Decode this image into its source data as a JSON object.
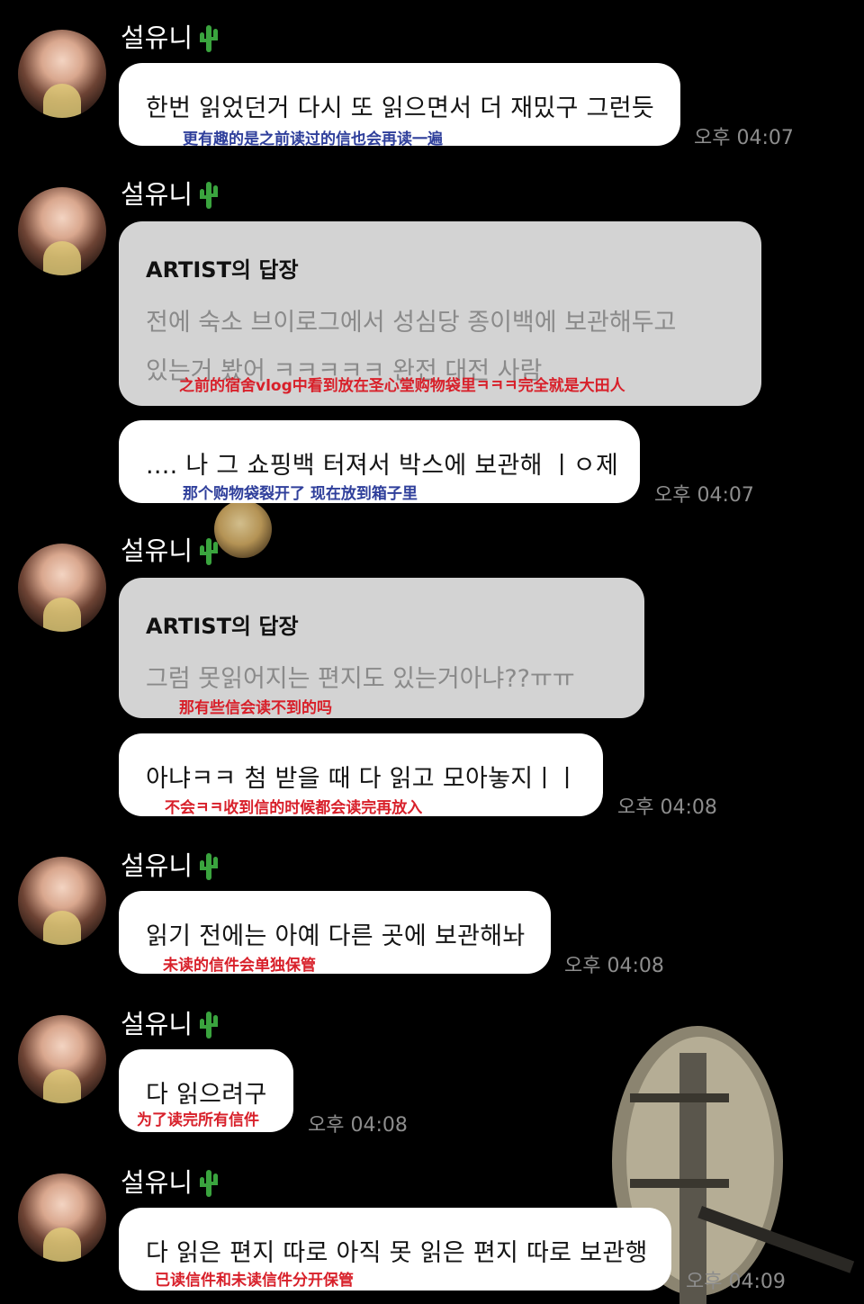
{
  "sender_name": "설유니",
  "messages": [
    {
      "text": "한번 읽었던거 다시 또 읽으면서 더 재밌구 그런듯",
      "translation": "更有趣的是之前读过的信也会再读一遍",
      "time": "오후 04:07"
    },
    {
      "reply_title": "ARTIST의 답장",
      "reply_lines": [
        "전에 숙소 브이로그에서 성심당 종이백에 보관해두고",
        "있는거 봤어 ㅋㅋㅋㅋㅋ 완전 대전 사람"
      ],
      "translation": "之前的宿舍vlog中看到放在圣心堂购物袋里ㅋㅋㅋ完全就是大田人"
    },
    {
      "text": ".... 나 그 쇼핑백 터져서 박스에 보관해 ㅣㅇ제",
      "translation": "那个购物袋裂开了 现在放到箱子里",
      "time": "오후 04:07"
    },
    {
      "reply_title": "ARTIST의 답장",
      "reply_lines": [
        "그럼 못읽어지는 편지도 있는거아냐??ㅠㅠ"
      ],
      "translation": "那有些信会读不到的吗"
    },
    {
      "text": "아냐ㅋㅋ 첨 받을 때 다 읽고 모아놓지ㅣㅣ",
      "translation": "不会ㅋㅋ收到信的时候都会读完再放入",
      "time": "오후 04:08"
    },
    {
      "text": "읽기 전에는 아예 다른 곳에 보관해놔",
      "translation": "未读的信件会单独保管",
      "time": "오후 04:08"
    },
    {
      "text": "다 읽으려구",
      "translation": "为了读完所有信件",
      "time": "오후 04:08"
    },
    {
      "text": "다 읽은 편지 따로 아직 못 읽은 편지 따로 보관행",
      "translation": "已读信件和未读信件分开保管",
      "time": "오후 04:09"
    }
  ],
  "colors": {
    "background": "#000000",
    "bubble": "#ffffff",
    "reply_bubble": "#d3d3d3",
    "translation_blue": "#2f3f9b",
    "translation_red": "#d8202a",
    "timestamp": "#8d8d8d"
  },
  "icons": [
    "cactus-icon",
    "avatar"
  ]
}
